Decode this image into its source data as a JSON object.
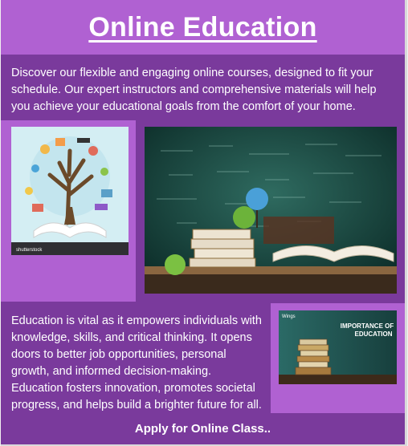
{
  "header": {
    "title": "Online Education"
  },
  "intro": {
    "text": "Discover our flexible and engaging online courses, designed to fit your schedule. Our expert instructors and comprehensive materials will help you achieve your educational goals from the comfort of your home."
  },
  "images": {
    "tree": {
      "icon": "education-tree-illustration",
      "credit": "shutterstock"
    },
    "board": {
      "icon": "chalkboard-books-apple-photo"
    },
    "books": {
      "icon": "importance-of-education-books-photo",
      "caption_line1": "IMPORTANCE OF",
      "caption_line2": "EDUCATION",
      "brand": "Wings"
    }
  },
  "body": {
    "text": "Education is vital as it empowers individuals with knowledge, skills, and critical thinking. It opens doors to better job opportunities, personal growth, and informed decision-making. Education fosters innovation, promotes societal progress, and helps build a brighter future for all."
  },
  "cta": {
    "label": "Apply for Online Class.."
  },
  "colors": {
    "frame": "#7a3a9c",
    "header": "#b061d2",
    "text": "#ffffff"
  }
}
